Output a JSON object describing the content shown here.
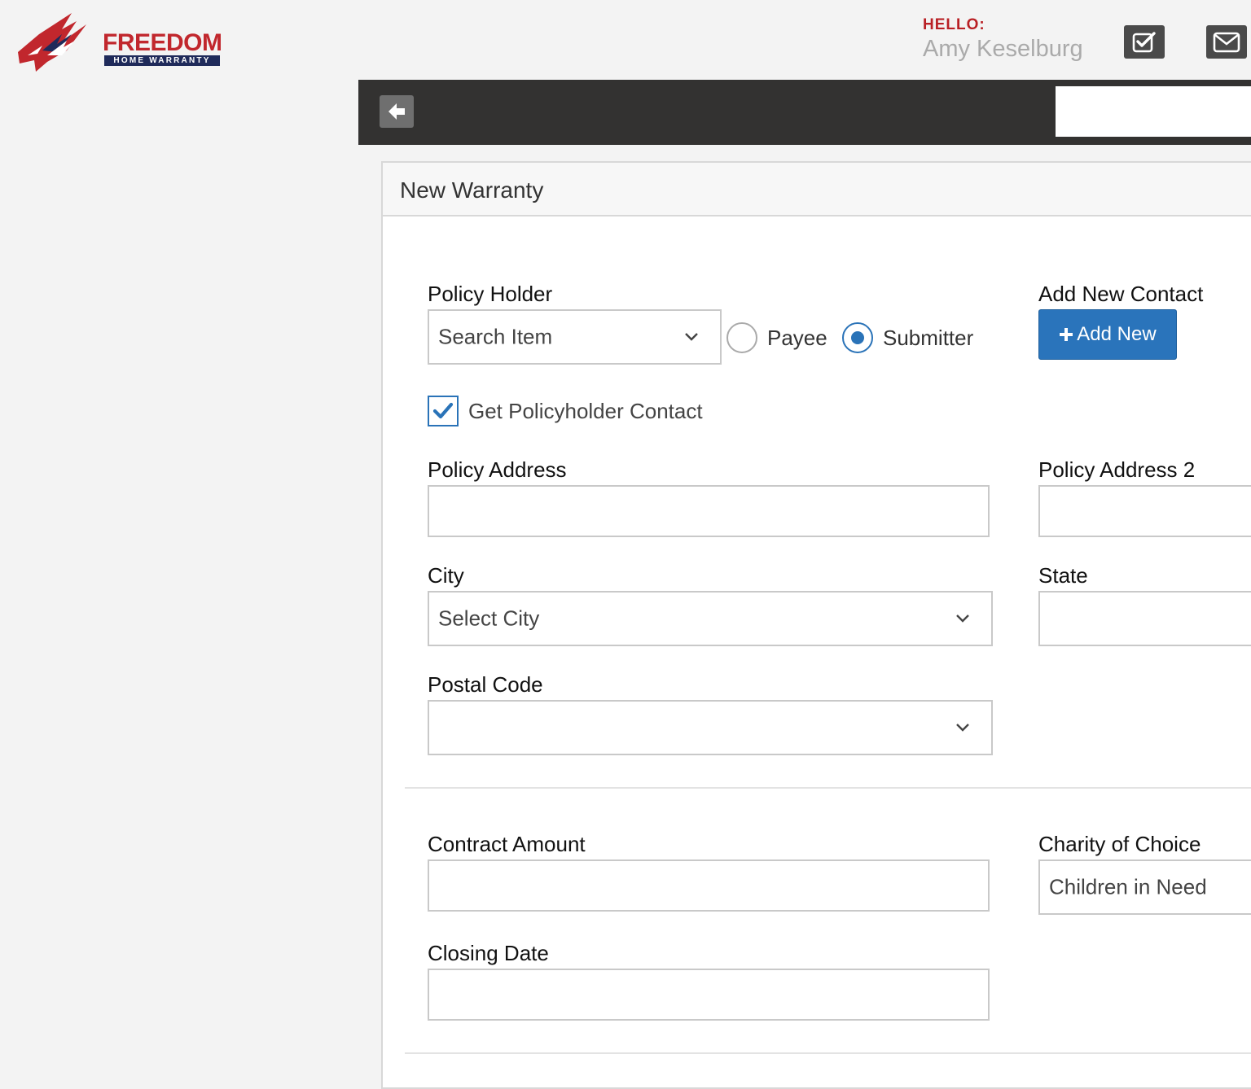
{
  "brand": {
    "name": "FREEDOM",
    "tagline": "HOME WARRANTY",
    "colors": {
      "red": "#c1272d",
      "navy": "#1f2a5a"
    }
  },
  "header": {
    "greeting": "HELLO:",
    "user_name": "Amy Keselburg",
    "tasks_icon": "checkbox-icon",
    "mail_icon": "envelope-icon"
  },
  "toolbar": {
    "back_icon": "arrow-left-icon"
  },
  "form": {
    "title": "New Warranty",
    "policy_holder": {
      "label": "Policy Holder",
      "value": "Search Item"
    },
    "role_options": [
      {
        "label": "Payee",
        "selected": false
      },
      {
        "label": "Submitter",
        "selected": true
      }
    ],
    "add_contact": {
      "label": "Add New Contact",
      "button": "Add New"
    },
    "get_contact": {
      "label": "Get Policyholder Contact",
      "checked": true
    },
    "policy_address": {
      "label": "Policy Address",
      "value": ""
    },
    "policy_address_2": {
      "label": "Policy Address 2",
      "value": ""
    },
    "city": {
      "label": "City",
      "value": "Select City"
    },
    "state": {
      "label": "State",
      "value": ""
    },
    "postal_code": {
      "label": "Postal Code",
      "value": ""
    },
    "contract_amount": {
      "label": "Contract Amount",
      "value": ""
    },
    "charity": {
      "label": "Charity of Choice",
      "value": "Children in Need"
    },
    "closing_date": {
      "label": "Closing Date",
      "value": ""
    }
  },
  "accent_color": "#2a74bb"
}
